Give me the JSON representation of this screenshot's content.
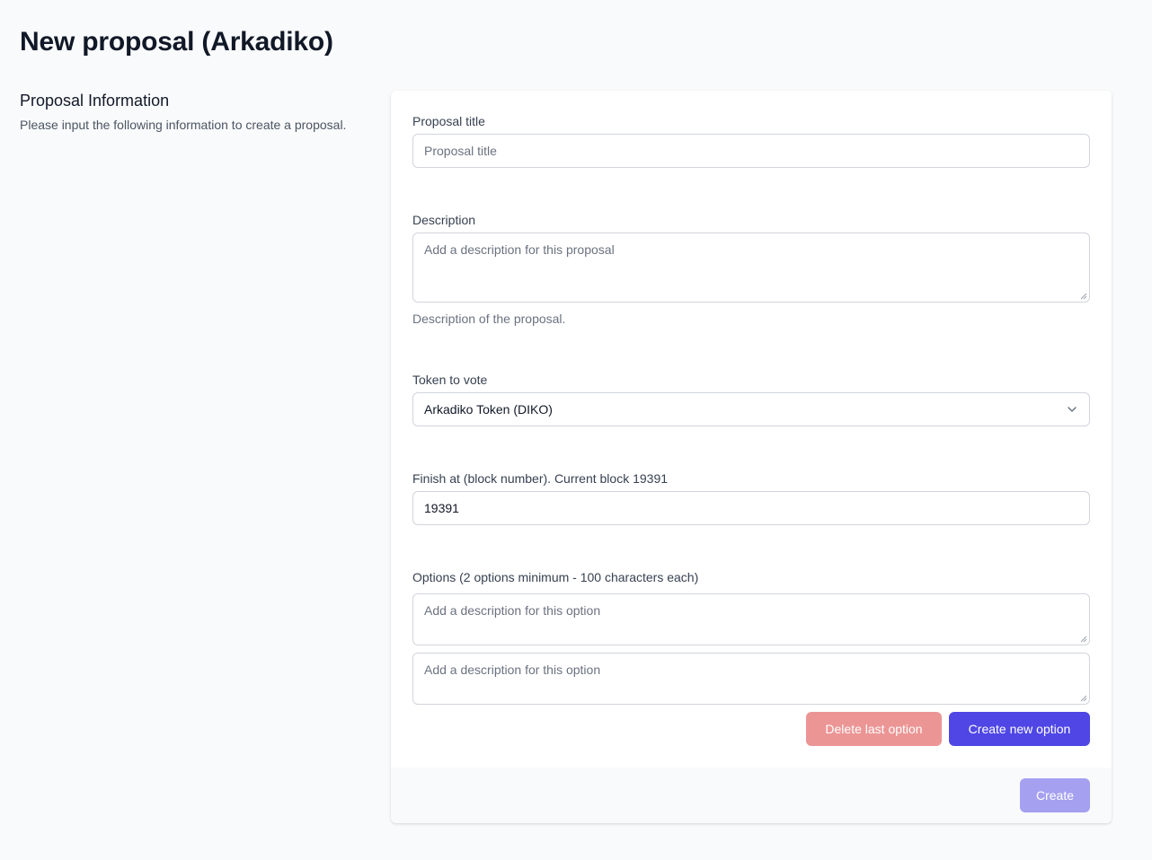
{
  "page": {
    "title": "New proposal (Arkadiko)"
  },
  "info": {
    "heading": "Proposal Information",
    "description": "Please input the following information to create a proposal."
  },
  "form": {
    "title": {
      "label": "Proposal title",
      "placeholder": "Proposal title",
      "value": ""
    },
    "description": {
      "label": "Description",
      "placeholder": "Add a description for this proposal",
      "help": "Description of the proposal."
    },
    "token": {
      "label": "Token to vote",
      "selected": "Arkadiko Token (DIKO)"
    },
    "finish": {
      "label": "Finish at (block number). Current block 19391",
      "value": "19391"
    },
    "options": {
      "label": "Options (2 options minimum - 100 characters each)",
      "items": [
        {
          "placeholder": "Add a description for this option"
        },
        {
          "placeholder": "Add a description for this option"
        }
      ],
      "delete_label": "Delete last option",
      "create_label": "Create new option"
    },
    "submit_label": "Create"
  },
  "colors": {
    "primary": "#4f46e5",
    "primary_disabled": "#a5a0f0",
    "danger_disabled": "#ec9595",
    "background": "#f9fafb"
  },
  "icons": {
    "select_chevron": "chevron-down-icon"
  }
}
